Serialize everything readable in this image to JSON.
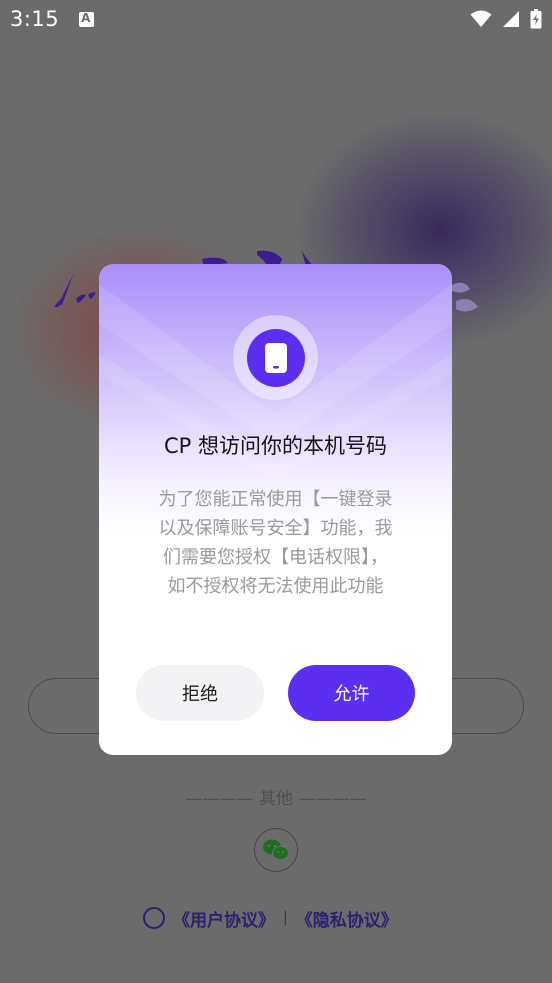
{
  "status_bar": {
    "time": "3:15"
  },
  "background": {
    "other_divider": "———— 其他 ————",
    "user_agreement": "《用户协议》",
    "privacy_policy": "《隐私协议》",
    "separator": "|"
  },
  "dialog": {
    "title": "CP 想访问你的本机号码",
    "body": "为了您能正常使用【一键登录以及保障账号安全】功能，我们需要您授权【电话权限】，如不授权将无法使用此功能",
    "reject_label": "拒绝",
    "allow_label": "允许",
    "icon": "phone-icon"
  },
  "colors": {
    "accent": "#5b2ef0",
    "dim_background": "#6d6d6d"
  }
}
